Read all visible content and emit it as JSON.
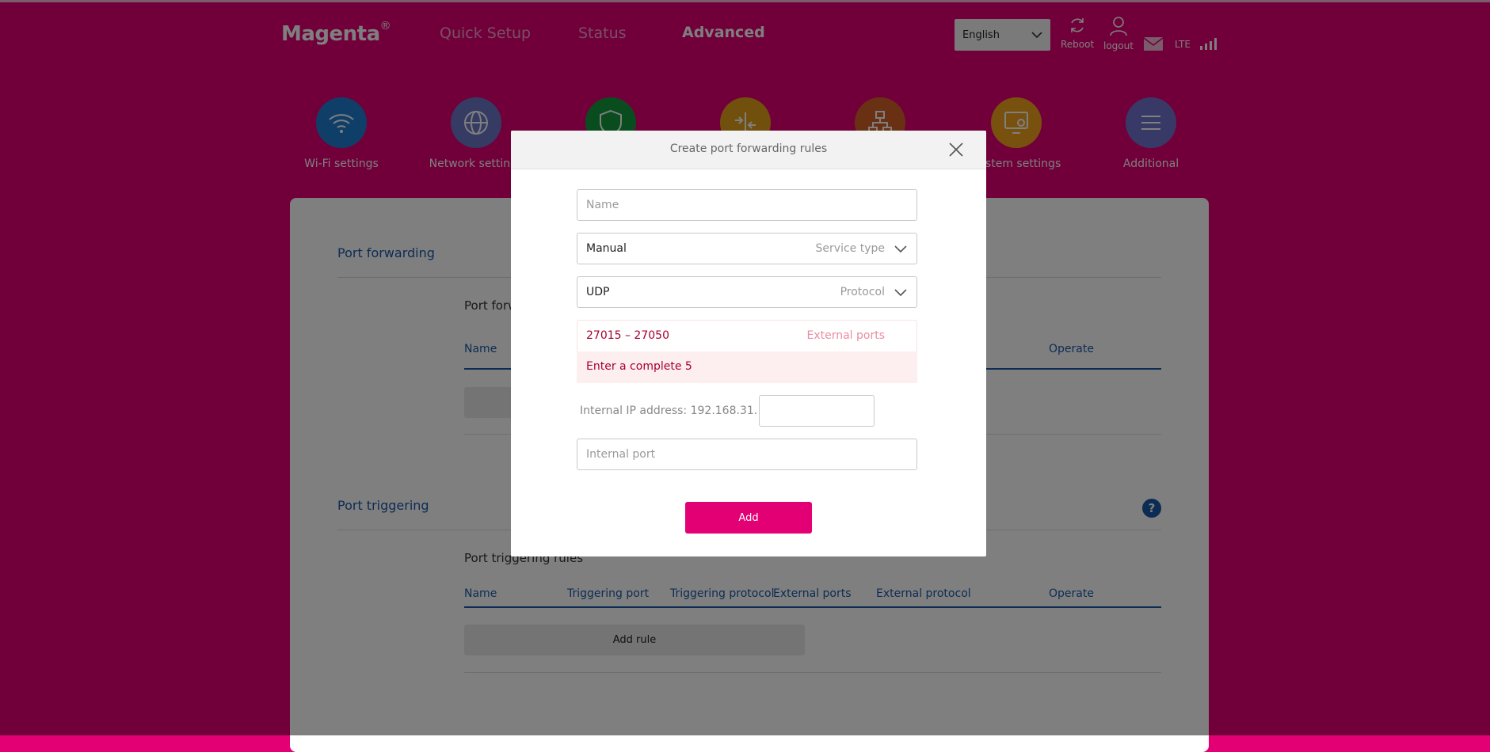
{
  "header": {
    "logo": "Magenta",
    "logo_mark": "®",
    "nav": {
      "quick_setup": "Quick Setup",
      "status": "Status",
      "advanced": "Advanced"
    },
    "language": "English",
    "reboot": "Reboot",
    "logout": "logout",
    "network_type": "LTE"
  },
  "tiles": {
    "wifi": "Wi-Fi settings",
    "network": "Network settings",
    "security": "",
    "nat": "",
    "lan": "",
    "system": "System settings",
    "additional": "Additional"
  },
  "colors": {
    "brand": "#e20074",
    "link_blue": "#1a59a8",
    "tile_wifi": "#1e7fd0",
    "tile_network": "#6b76c6",
    "tile_security": "#129a3f",
    "tile_nat": "#e3a11a",
    "tile_lan": "#d46127",
    "tile_system": "#f0a21e",
    "tile_additional": "#7173cf",
    "error_text": "#a8002f"
  },
  "port_forwarding": {
    "section_title": "Port forwarding",
    "rules_title": "Port forwarding rules",
    "col_name": "Name",
    "col_operate": "Operate"
  },
  "port_triggering": {
    "section_title": "Port triggering",
    "rules_title": "Port triggering rules",
    "columns": [
      "Name",
      "Triggering port",
      "Triggering protocol",
      "External ports",
      "External protocol",
      "Operate"
    ],
    "add_rule": "Add rule",
    "help": "?"
  },
  "modal": {
    "title": "Create port forwarding rules",
    "name_placeholder": "Name",
    "service_type": {
      "value": "Manual",
      "label": "Service type"
    },
    "protocol": {
      "value": "UDP",
      "label": "Protocol"
    },
    "external_ports": {
      "value": "27015 – 27050",
      "label": "External ports"
    },
    "error_message": "Enter a complete 5",
    "internal_ip_label": "Internal IP address: 192.168.31.",
    "internal_ip_value": "",
    "internal_port_placeholder": "Internal port",
    "add_button": "Add"
  }
}
